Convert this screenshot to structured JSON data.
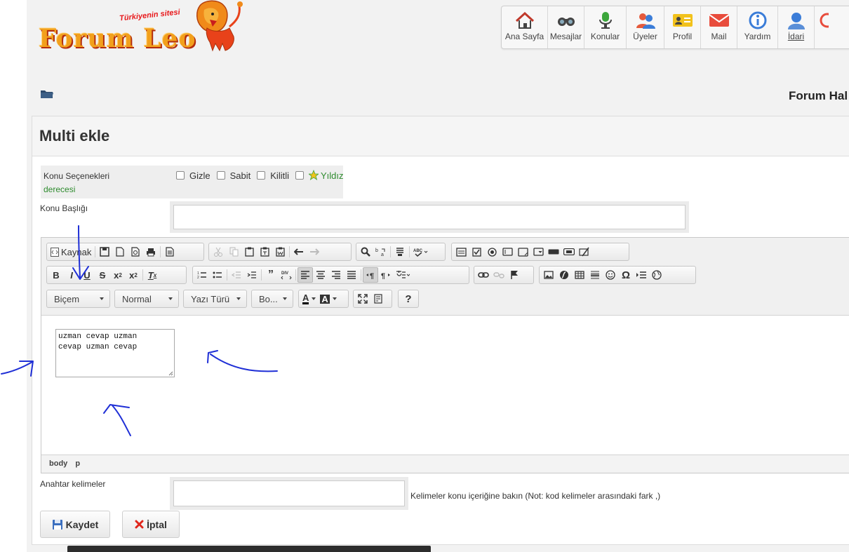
{
  "header": {
    "logo_text": "Forum Leo",
    "logo_tagline": "Türkiyenin sitesi",
    "nav": [
      {
        "label": "Ana Sayfa",
        "icon": "home-icon"
      },
      {
        "label": "Mesajlar",
        "icon": "binoculars-icon"
      },
      {
        "label": "Konular",
        "icon": "microphone-icon"
      },
      {
        "label": "Üyeler",
        "icon": "users-icon"
      },
      {
        "label": "Profil",
        "icon": "id-card-icon"
      },
      {
        "label": "Mail",
        "icon": "envelope-icon"
      },
      {
        "label": "Yardım",
        "icon": "info-icon"
      },
      {
        "label": "İdari",
        "icon": "admin-user-icon"
      }
    ]
  },
  "breadcrumb": {
    "title": "Forum Hal"
  },
  "form": {
    "heading": "Multi ekle",
    "topic_options_label": "Konu Seçenekleri",
    "topic_options_sub": "derecesi",
    "options": [
      "Gizle",
      "Sabit",
      "Kilitli",
      "Yıldız"
    ],
    "title_label": "Konu Başlığı",
    "title_value": "",
    "keywords_label": "Anahtar kelimeler",
    "keywords_value": "",
    "keywords_note": "Kelimeler konu içeriğine bakın (Not: kod kelimeler arasındaki fark ,)",
    "save_label": "Kaydet",
    "cancel_label": "İptal"
  },
  "editor": {
    "source_label": "Kaynak",
    "combos": {
      "format": "Biçem",
      "style": "Normal",
      "font": "Yazı Türü",
      "size": "Bo..."
    },
    "help_label": "?",
    "content_line1": "uzman cevap uzman",
    "content_line2": "cevap uzman cevap",
    "path": [
      "body",
      "p"
    ]
  },
  "colors": {
    "accent_green": "#2e8b2e",
    "annotation_blue": "#1f2fd6",
    "logo_orange": "#f2a01c",
    "logo_red": "#e8181b"
  }
}
